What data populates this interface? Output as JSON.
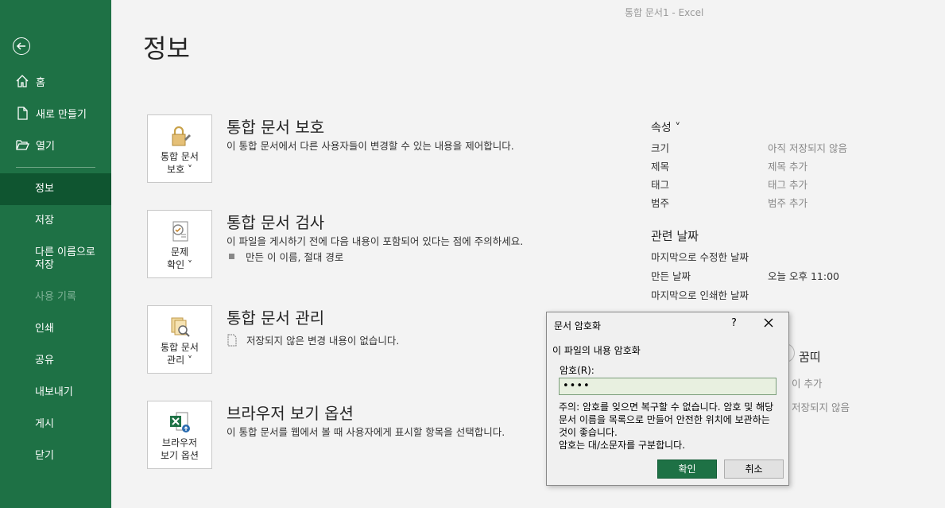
{
  "window": {
    "title": "통합 문서1  -  Excel"
  },
  "sidebar": {
    "top_items": [
      {
        "label": "홈",
        "icon": "home-icon"
      },
      {
        "label": "새로 만들기",
        "icon": "new-file-icon"
      },
      {
        "label": "열기",
        "icon": "open-folder-icon"
      }
    ],
    "items": [
      {
        "label": "정보",
        "selected": true
      },
      {
        "label": "저장"
      },
      {
        "label": "다른 이름으로 저장"
      },
      {
        "label": "사용 기록",
        "disabled": true
      },
      {
        "label": "인쇄"
      },
      {
        "label": "공유"
      },
      {
        "label": "내보내기"
      },
      {
        "label": "게시"
      },
      {
        "label": "닫기"
      }
    ],
    "colors": {
      "background": "#1e7145",
      "selected": "#0f5530"
    }
  },
  "page": {
    "title": "정보"
  },
  "sections": [
    {
      "tile_label": "통합 문서\n보호 ˅",
      "title": "통합 문서 보호",
      "description": "이 통합 문서에서 다른 사용자들이 변경할 수 있는 내용을 제어합니다."
    },
    {
      "tile_label": "문제\n확인 ˅",
      "title": "통합 문서 검사",
      "description": "이 파일을 게시하기 전에 다음 내용이 포함되어 있다는 점에 주의하세요.",
      "sub_item": "만든 이 이름, 절대 경로"
    },
    {
      "tile_label": "통합 문서\n관리 ˅",
      "title": "통합 문서 관리",
      "description": "",
      "sub_item": "저장되지 않은 변경 내용이 없습니다."
    },
    {
      "tile_label": "브라우저\n보기 옵션",
      "title": "브라우저 보기 옵션",
      "description": "이 통합 문서를 웹에서 볼 때 사용자에게 표시할 항목을 선택합니다."
    }
  ],
  "properties": {
    "heading": "속성 ˅",
    "rows": [
      {
        "label": "크기",
        "value": "아직 저장되지 않음"
      },
      {
        "label": "제목",
        "value": "제목 추가"
      },
      {
        "label": "태그",
        "value": "태그 추가"
      },
      {
        "label": "범주",
        "value": "범주 추가"
      }
    ],
    "dates_heading": "관련 날짜",
    "date_rows": [
      {
        "label": "마지막으로 수정한 날짜",
        "value": ""
      },
      {
        "label": "만든 날짜",
        "value": "오늘 오후 11:00"
      },
      {
        "label": "마지막으로 인쇄한 날짜",
        "value": ""
      }
    ],
    "partial": {
      "people_heading": "꿈띠",
      "author_add": "이 추가",
      "last_modified_by": "저장되지 않음"
    }
  },
  "dialog": {
    "title": "문서 암호화",
    "help": "?",
    "heading": "이 파일의 내용 암호화",
    "password_label": "암호(R):",
    "password_value": "••••",
    "warning": "주의: 암호를 잊으면 복구할 수 없습니다. 암호 및 해당 문서 이름을 목록으로 만들어 안전한 위치에 보관하는 것이 좋습니다.",
    "case_note": "암호는 대/소문자를 구분합니다.",
    "ok_label": "확인",
    "cancel_label": "취소"
  }
}
